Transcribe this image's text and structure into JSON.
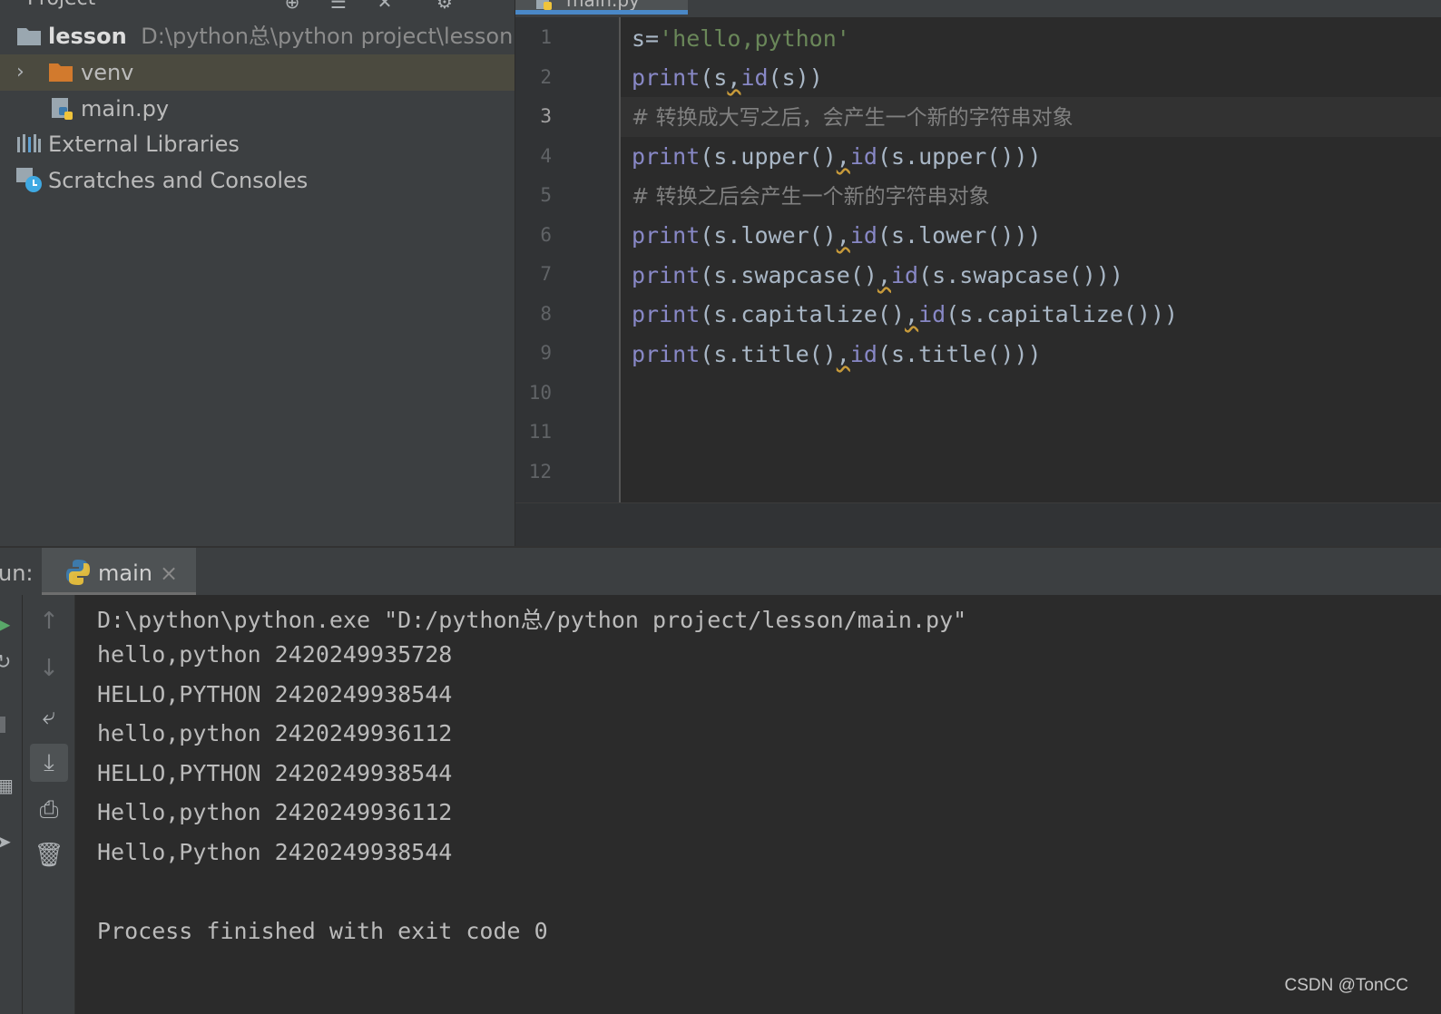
{
  "project": {
    "header_title": "Project",
    "tree": [
      {
        "label": "lesson",
        "path": "D:\\python总\\python project\\lesson",
        "icon": "folder-icon"
      },
      {
        "label": "venv",
        "icon": "folder-orange-icon"
      },
      {
        "label": "main.py",
        "icon": "python-file-icon"
      },
      {
        "label": "External Libraries",
        "icon": "libraries-icon"
      },
      {
        "label": "Scratches and Consoles",
        "icon": "scratches-icon"
      }
    ]
  },
  "editor": {
    "tab_label": "main.py",
    "line_numbers": [
      "1",
      "2",
      "3",
      "4",
      "5",
      "6",
      "7",
      "8",
      "9",
      "10",
      "11",
      "12"
    ],
    "current_line": "3",
    "code": {
      "l1_a": "s=",
      "l1_str": "'hello,python'",
      "l2_kw": "print",
      "l2_a": "(s",
      "l2_comma": ",",
      "l2_kw2": "id",
      "l2_b": "(s))",
      "l3_cm": "# 转换成大写之后，会产生一个新的字符串对象",
      "l4_kw": "print",
      "l4_a": "(s.upper()",
      "l4_comma": ",",
      "l4_kw2": "id",
      "l4_b": "(s.upper()))",
      "l5_cm": "# 转换之后会产生一个新的字符串对象",
      "l6_kw": "print",
      "l6_a": "(s.lower()",
      "l6_comma": ",",
      "l6_kw2": "id",
      "l6_b": "(s.lower()))",
      "l7_kw": "print",
      "l7_a": "(s.swapcase()",
      "l7_comma": ",",
      "l7_kw2": "id",
      "l7_b": "(s.swapcase()))",
      "l8_kw": "print",
      "l8_a": "(s.capitalize()",
      "l8_comma": ",",
      "l8_kw2": "id",
      "l8_b": "(s.capitalize()))",
      "l9_kw": "print",
      "l9_a": "(s.title()",
      "l9_comma": ",",
      "l9_kw2": "id",
      "l9_b": "(s.title()))"
    }
  },
  "run": {
    "label": "un:",
    "tab_label": "main",
    "close": "×",
    "output": [
      "D:\\python\\python.exe \"D:/python总/python project/lesson/main.py\"",
      "hello,python 2420249935728",
      "HELLO,PYTHON 2420249938544",
      "hello,python 2420249936112",
      "HELLO,PYTHON 2420249938544",
      "Hello,python 2420249936112",
      "Hello,Python 2420249938544",
      "",
      "Process finished with exit code 0"
    ],
    "toolbar_icons": [
      "up-arrow-icon",
      "down-arrow-icon",
      "soft-wrap-icon",
      "scroll-to-end-icon",
      "print-icon",
      "trash-icon"
    ]
  },
  "watermark": "CSDN @TonCC"
}
